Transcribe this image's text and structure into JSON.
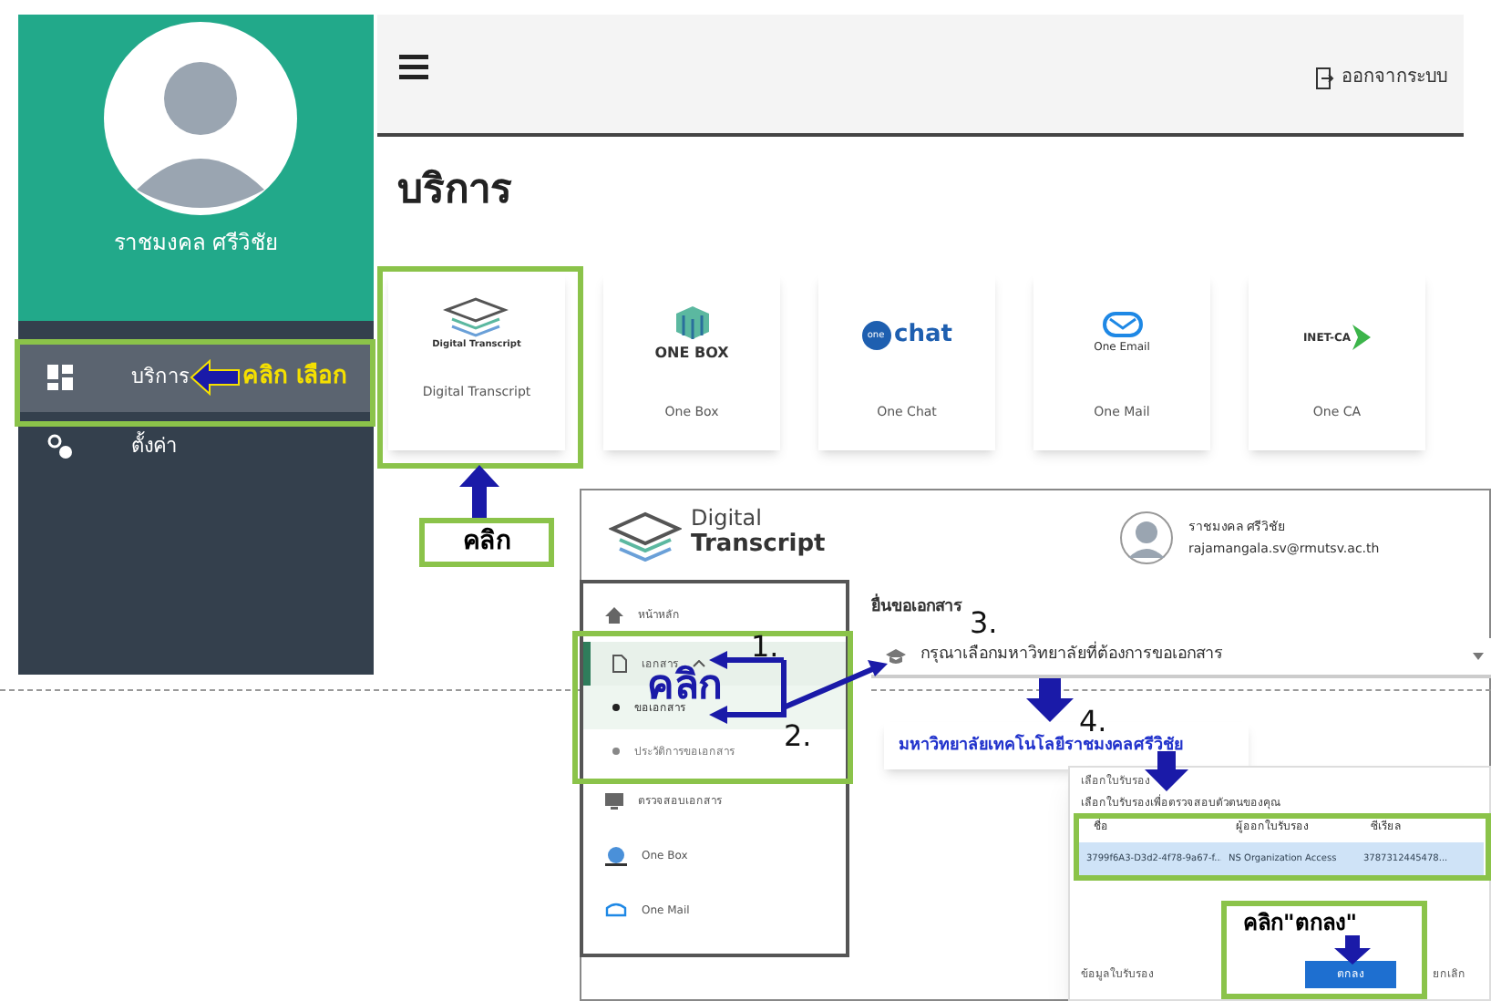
{
  "profile_panel": {
    "user_name": "ราชมงคล ศรีวิชัย",
    "menu": [
      {
        "label": "บริการ",
        "selected": true
      },
      {
        "label": "ตั้งค่า",
        "selected": false
      }
    ]
  },
  "services_page": {
    "logout": "ออกจากระบบ",
    "title": "บริการ",
    "services": [
      {
        "logo_text": "Digital Transcript",
        "label": "Digital Transcript"
      },
      {
        "logo_text": "ONE BOX",
        "label": "One Box"
      },
      {
        "logo_text": "chat",
        "logo_badge": "one",
        "label": "One Chat"
      },
      {
        "logo_text": "One Email",
        "label": "One Mail"
      },
      {
        "logo_text": "INET-CA",
        "label": "One CA"
      }
    ]
  },
  "transcript_app": {
    "brand_line_1": "Digital",
    "brand_line_2": "Transcript",
    "user_name": "ราชมงคล ศรีวิชัย",
    "user_email": "rajamangala.sv@rmutsv.ac.th",
    "menu": [
      {
        "label": "หน้าหลัก"
      },
      {
        "label": "เอกสาร",
        "expanded": true,
        "children": [
          {
            "label": "ขอเอกสาร",
            "selected": true
          },
          {
            "label": "ประวัติการขอเอกสาร",
            "selected": false
          }
        ]
      },
      {
        "label": "ตรวจสอบเอกสาร"
      },
      {
        "label": "One Box"
      },
      {
        "label": "One Mail"
      }
    ],
    "section_title": "ยื่นขอเอกสาร",
    "select_placeholder": "กรุณาเลือกมหาวิทยาลัยที่ต้องการขอเอกสาร",
    "university_option": "มหาวิทยาลัยเทคโนโลยีราชมงคลศรีวิชัย",
    "cert_dialog": {
      "title": "เลือกใบรับรอง",
      "description": "เลือกใบรับรองเพื่อตรวจสอบตัวตนของคุณ",
      "columns": [
        "ชื่อ",
        "ผู้ออกใบรับรอง",
        "ซีเรียล"
      ],
      "row": [
        "3799f6A3-D3d2-4f78-9a67-f...",
        "NS Organization Access",
        "3787312445478..."
      ],
      "details_button": "ข้อมูลใบรับรอง",
      "ok_button": "ตกลง",
      "cancel_button": "ยกเลิก"
    }
  },
  "annotations": {
    "click_select": "คลิก เลือก",
    "click": "คลิก",
    "click_app": "คลิก",
    "step_1": "1.",
    "step_2": "2.",
    "step_3": "3.",
    "step_4": "4.",
    "click_ok": "คลิก\"ตกลง\""
  }
}
